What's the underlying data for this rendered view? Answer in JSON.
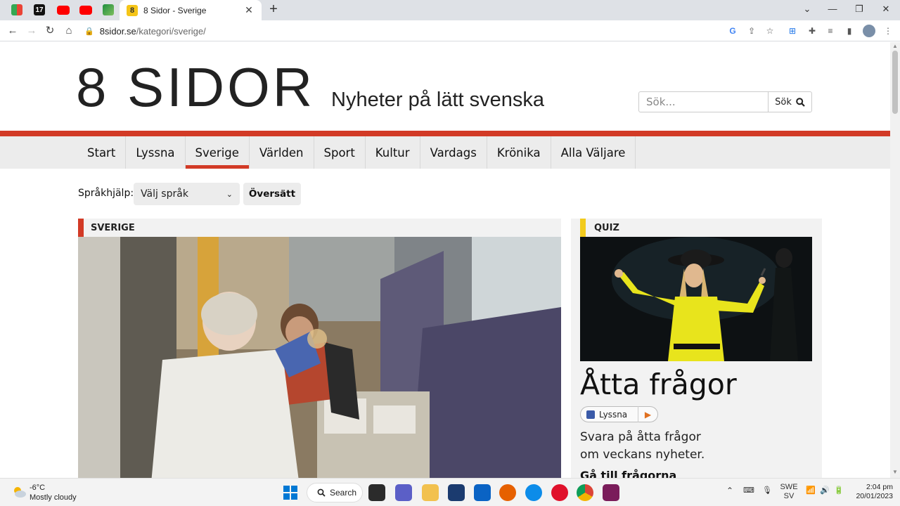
{
  "browser": {
    "tab_title": "8 Sidor - Sverige",
    "tab_favicon_text": "8",
    "url_domain": "8sidor.se",
    "url_path": "/kategori/sverige/"
  },
  "site": {
    "logo": "8 SIDOR",
    "tagline": "Nyheter på lätt svenska",
    "search_placeholder": "Sök...",
    "search_button": "Sök"
  },
  "nav": {
    "items": [
      "Start",
      "Lyssna",
      "Sverige",
      "Världen",
      "Sport",
      "Kultur",
      "Vardags",
      "Krönika",
      "Alla Väljare"
    ],
    "active": "Sverige"
  },
  "language": {
    "label": "Språkhjälp:",
    "select_value": "Välj språk",
    "translate_button": "Översätt"
  },
  "main_article": {
    "category": "SVERIGE"
  },
  "side_article": {
    "category": "QUIZ",
    "title": "Åtta frågor",
    "listen_label": "Lyssna",
    "description_line1": "Svara på åtta frågor",
    "description_line2": "om veckans nyheter.",
    "link": "Gå till frågorna"
  },
  "taskbar": {
    "weather_temp": "-6°C",
    "weather_desc": "Mostly cloudy",
    "search_label": "Search",
    "lang_top": "SWE",
    "lang_bottom": "SV",
    "time": "2:04 pm",
    "date": "20/01/2023"
  },
  "colors": {
    "accent_red": "#d23a26",
    "quiz_yellow": "#f2cb1d",
    "nav_bg": "#ececec"
  }
}
